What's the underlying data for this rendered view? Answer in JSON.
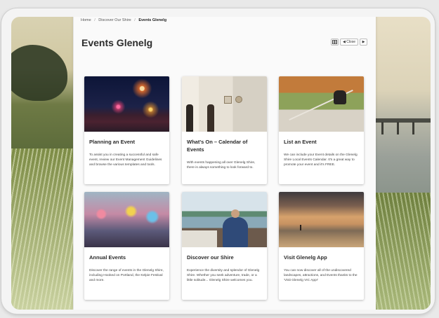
{
  "breadcrumb": {
    "items": [
      "Home",
      "Discover Our Shire",
      "Events Glenelg"
    ],
    "separator": "/"
  },
  "page": {
    "title": "Events Glenelg",
    "toolbar": {
      "grid_icon": "grid-view-icon",
      "prev_label": "◀ Close",
      "next_label": "▶"
    }
  },
  "cards": [
    {
      "title": "Planning an Event",
      "description": "To assist you in creating a successful and safe event, review our Event Management Guidelines and browse the various templates and tools.",
      "image": "fireworks-over-water"
    },
    {
      "title": "What's On – Calendar of Events",
      "description": "With events happening all over Glenelg Shire, there is always something to look forward to.",
      "image": "art-gallery-visitors"
    },
    {
      "title": "List an Event",
      "description": "We can include your Event details on the Glenelg Shire Local Events Calendar. It's a great way to promote your event and it's FREE.",
      "image": "sheep-dog-on-fence"
    },
    {
      "title": "Annual Events",
      "description": "Discover the range of events in the Glenelg Shire, including Hooked on Portland, the Kelpie Festival and more.",
      "image": "parade-crowd"
    },
    {
      "title": "Discover our Shire",
      "description": "Experience the diversity and splendor of Glenelg Shire. Whether you seek adventure, trade, or a little solitude... Glenelg Shire welcomes you.",
      "image": "man-on-boat"
    },
    {
      "title": "Visit Glenelg App",
      "description": "You can now discover all of the undiscovered landscapes, attractions, and Events thanks to the 'Visit Glenelg VIC App!'",
      "image": "beach-sunset"
    }
  ]
}
